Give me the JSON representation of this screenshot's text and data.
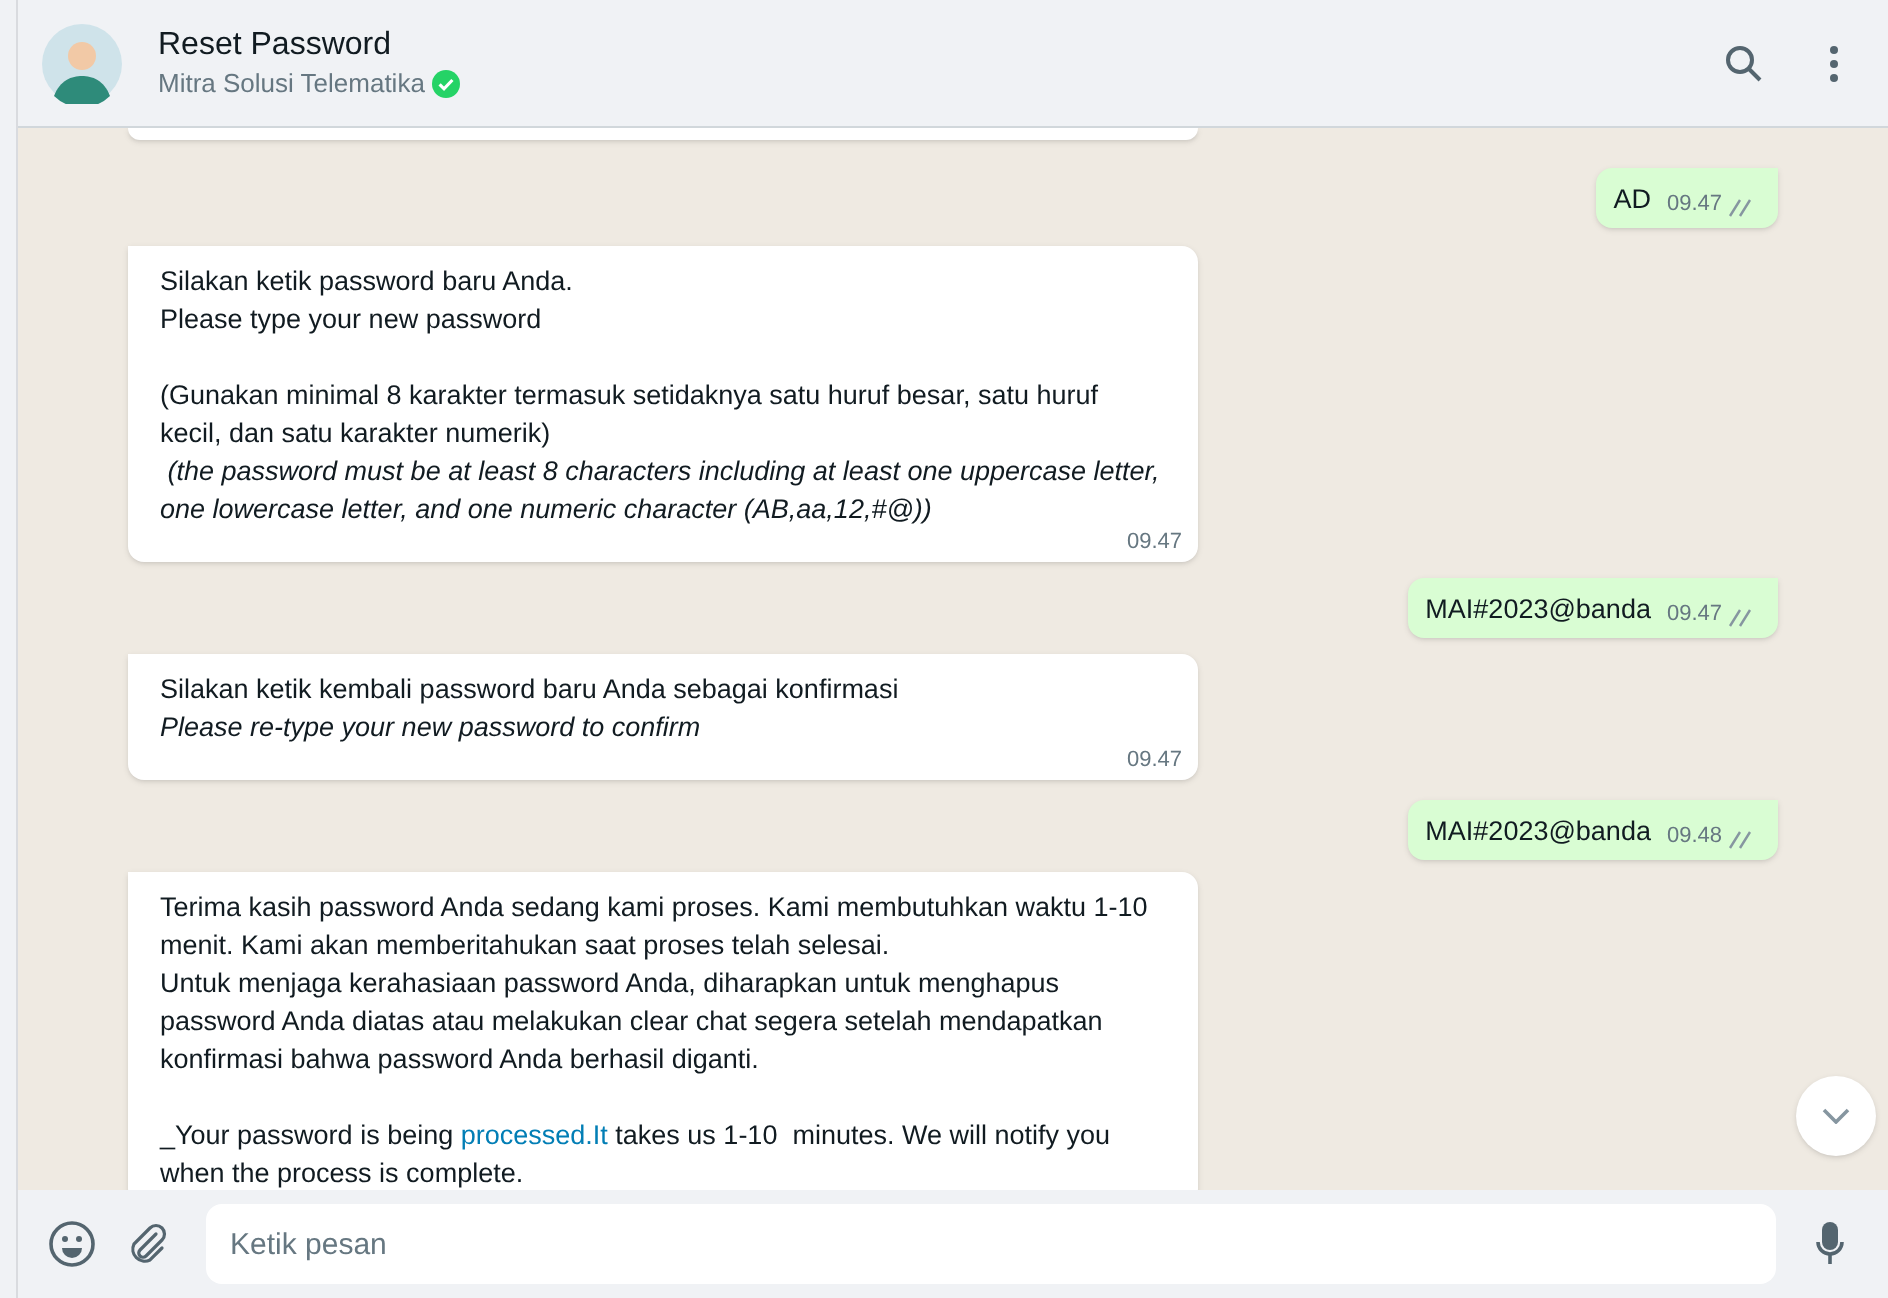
{
  "header": {
    "title": "Reset Password",
    "subtitle": "Mitra Solusi Telematika",
    "verified": true
  },
  "messages": [
    {
      "kind": "sent",
      "text": "AD",
      "time": "09.47",
      "read": true
    },
    {
      "kind": "received",
      "time": "09.47",
      "groups": [
        [
          {
            "text": "Silakan ketik password baru Anda.",
            "italic": false
          },
          {
            "text": "Please type your new password",
            "italic": false
          }
        ],
        [
          {
            "text": "(Gunakan minimal 8 karakter termasuk setidaknya satu huruf besar, satu huruf kecil, dan satu karakter numerik)",
            "italic": false
          },
          {
            "text": " (the password must be at least 8 characters including at least one uppercase letter, one lowercase letter, and one numeric character (AB,aa,12,#@))",
            "italic": true
          }
        ]
      ]
    },
    {
      "kind": "sent",
      "text": "MAI#2023@banda",
      "time": "09.47",
      "read": true
    },
    {
      "kind": "received",
      "time": "09.47",
      "groups": [
        [
          {
            "text": "Silakan ketik kembali password baru Anda sebagai konfirmasi",
            "italic": false
          },
          {
            "text": "Please re-type your new password to confirm",
            "italic": true
          }
        ]
      ]
    },
    {
      "kind": "sent",
      "text": "MAI#2023@banda",
      "time": "09.48",
      "read": true
    },
    {
      "kind": "received",
      "groups": [
        [
          {
            "text": "Terima kasih password Anda sedang kami proses. Kami membutuhkan waktu 1-10 menit. Kami akan memberitahukan saat proses telah selesai.",
            "italic": false
          },
          {
            "text": "Untuk menjaga kerahasiaan password Anda, diharapkan untuk menghapus password Anda diatas atau melakukan clear chat segera setelah mendapatkan konfirmasi bahwa password Anda berhasil diganti.",
            "italic": false
          }
        ],
        [
          {
            "parts": [
              {
                "text": "_Your password is being ",
                "link": false
              },
              {
                "text": "processed.It",
                "link": true
              },
              {
                "text": " takes us 1-10  minutes. We will notify you when the process is complete.",
                "link": false
              }
            ],
            "italic": false
          }
        ]
      ]
    }
  ],
  "composer": {
    "placeholder": "Ketik pesan"
  }
}
